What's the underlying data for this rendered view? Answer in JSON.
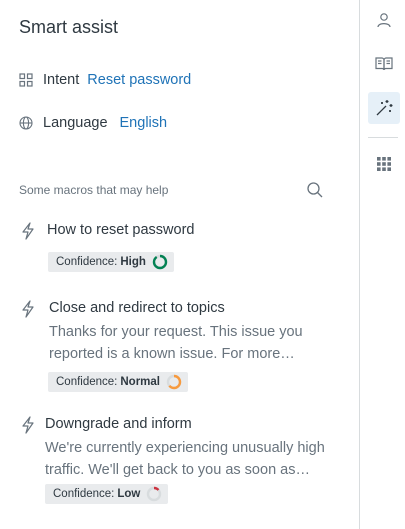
{
  "panel": {
    "title": "Smart assist",
    "intent": {
      "label": "Intent",
      "value": "Reset password",
      "icon": "grid-icon"
    },
    "language": {
      "label": "Language",
      "value": "English",
      "icon": "globe-icon"
    },
    "macros_header": "Some macros that may help"
  },
  "macros": [
    {
      "name": "How to reset password",
      "preview": "",
      "confidence_label": "Confidence:",
      "confidence_value": "High",
      "confidence_color": "#038153"
    },
    {
      "name": "Close and redirect to topics",
      "preview": "Thanks for your request. This issue you reported is a known issue. For more…",
      "confidence_label": "Confidence:",
      "confidence_value": "Normal",
      "confidence_color": "#f79a3e"
    },
    {
      "name": "Downgrade and inform",
      "preview": "We're currently experiencing unusually high traffic. We'll get back to you as soon as…",
      "confidence_label": "Confidence:",
      "confidence_value": "Low",
      "confidence_color": "#cc3340"
    }
  ],
  "rail": [
    {
      "icon": "person-icon",
      "active": false
    },
    {
      "icon": "book-icon",
      "active": false
    },
    {
      "icon": "magic-wand-icon",
      "active": true
    },
    {
      "icon": "apps-grid-icon",
      "active": false
    }
  ],
  "colors": {
    "link": "#1f73b7",
    "text": "#2f3941",
    "muted": "#68737d",
    "badge_bg": "#e9ebed",
    "active_rail_bg": "#e6f0f8"
  }
}
